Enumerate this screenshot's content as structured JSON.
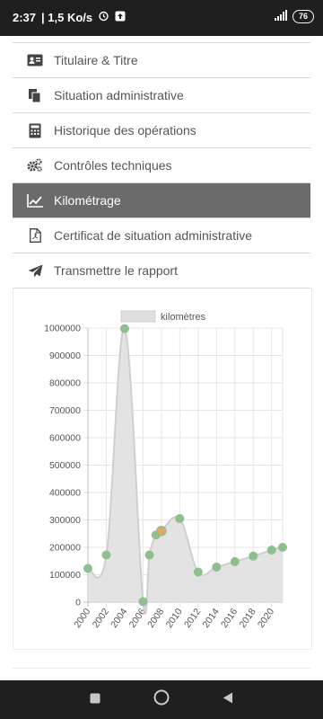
{
  "status_bar": {
    "time": "2:37",
    "speed": "| 1,5 Ko/s",
    "battery": "76",
    "colors": {
      "background": "#1f1f1f",
      "text": "#ffffff"
    }
  },
  "menu": {
    "items": [
      {
        "label": "Titulaire & Titre",
        "icon": "id-card-icon",
        "active": false
      },
      {
        "label": "Situation administrative",
        "icon": "documents-icon",
        "active": false
      },
      {
        "label": "Historique des opérations",
        "icon": "calculator-icon",
        "active": false
      },
      {
        "label": "Contrôles techniques",
        "icon": "gears-icon",
        "active": false
      },
      {
        "label": "Kilométrage",
        "icon": "line-chart-icon",
        "active": true
      },
      {
        "label": "Certificat de situation administrative",
        "icon": "pdf-file-icon",
        "active": false
      },
      {
        "label": "Transmettre le rapport",
        "icon": "paper-plane-icon",
        "active": false
      }
    ],
    "colors": {
      "active_bg": "#6b6b6b",
      "text": "#555555"
    }
  },
  "chart_data": {
    "type": "area",
    "legend": "kilomètres",
    "legend_position": "top",
    "x": [
      2000,
      2002,
      2004,
      2006,
      2006.7,
      2007.4,
      2008,
      2010,
      2012,
      2014,
      2016,
      2018,
      2020,
      2021.2
    ],
    "values": [
      123000,
      172000,
      998000,
      2000,
      172000,
      245000,
      260000,
      305000,
      110000,
      128000,
      148000,
      168000,
      190000,
      200000
    ],
    "highlight_index": 6,
    "xlim": [
      2000,
      2021.2
    ],
    "ylim": [
      0,
      1000000
    ],
    "x_ticks": [
      "2000",
      "2002",
      "2004",
      "2006",
      "2008",
      "2010",
      "2012",
      "2014",
      "2016",
      "2018",
      "2020"
    ],
    "y_ticks": [
      "0",
      "100000",
      "200000",
      "300000",
      "400000",
      "500000",
      "600000",
      "700000",
      "800000",
      "900000",
      "1000000"
    ],
    "grid": true,
    "colors": {
      "fill": "#e0e0e0",
      "line": "#cfcfcf",
      "point": "#8fbf8f",
      "highlight": "#e2a85c"
    }
  }
}
